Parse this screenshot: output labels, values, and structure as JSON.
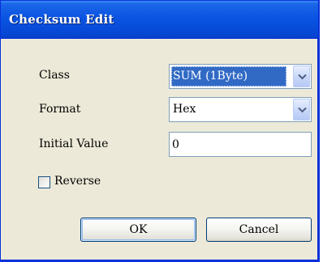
{
  "window": {
    "title": "Checksum Edit"
  },
  "form": {
    "class_label": "Class",
    "class_value": "SUM (1Byte)",
    "format_label": "Format",
    "format_value": "Hex",
    "initial_value_label": "Initial Value",
    "initial_value": "0",
    "reverse_label": "Reverse",
    "reverse_checked": false
  },
  "buttons": {
    "ok_label": "OK",
    "cancel_label": "Cancel"
  },
  "colors": {
    "titlebar": "#0a54e2",
    "dialog_background": "#ece9d8",
    "selection": "#316ac5"
  },
  "icons": {
    "combo_arrow": "chevron-down-icon"
  }
}
